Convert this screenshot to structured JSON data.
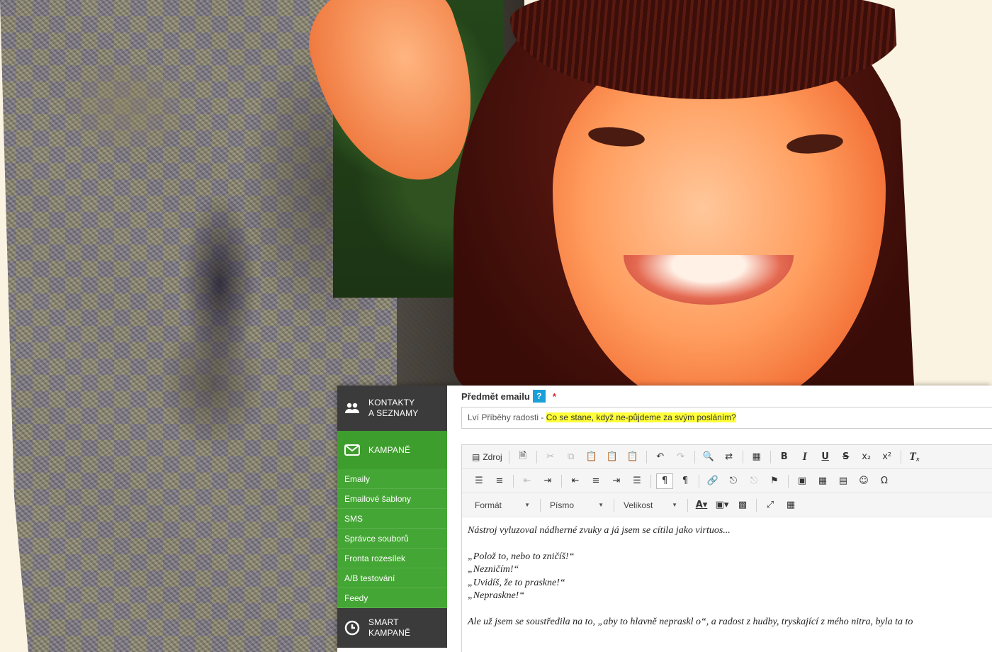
{
  "sidebar": {
    "contacts": {
      "label": "KONTAKTY\nA SEZNAMY",
      "icon": "people-icon"
    },
    "campaigns": {
      "label": "KAMPANĚ",
      "icon": "envelope-icon"
    },
    "subitems": [
      "Emaily",
      "Emailové šablony",
      "SMS",
      "Správce souborů",
      "Fronta rozesílek",
      "A/B testování",
      "Feedy"
    ],
    "smart": {
      "label": "SMART\nKAMPANĚ",
      "icon": "clock-icon"
    },
    "colors": {
      "dark": "#3b3b3b",
      "green": "#44a634"
    }
  },
  "subject": {
    "label": "Předmět emailu",
    "help": "?",
    "required_mark": "*",
    "value_prefix": "Lví Příběhy radosti - ",
    "value_highlight": "Co se stane, když ne-půjdeme za svým posláním?",
    "highlight_color": "#ffff3a"
  },
  "toolbar": {
    "source_label": "Zdroj",
    "format_label": "Formát",
    "font_label": "Písmo",
    "size_label": "Velikost"
  },
  "editor": {
    "lines": [
      "Nástroj vyluzoval nádherné zvuky a já jsem se cítila jako virtuos...",
      "„Polož to, nebo to zničíš!“",
      "„Nezničím!“",
      "„Uvidíš, že to praskne!“",
      "„Nepraskne!“",
      "Ale už jsem se soustředila na to, „aby to hlavně nepraskl o“, a radost z hudby, tryskající z mého nitra, byla ta to"
    ]
  }
}
